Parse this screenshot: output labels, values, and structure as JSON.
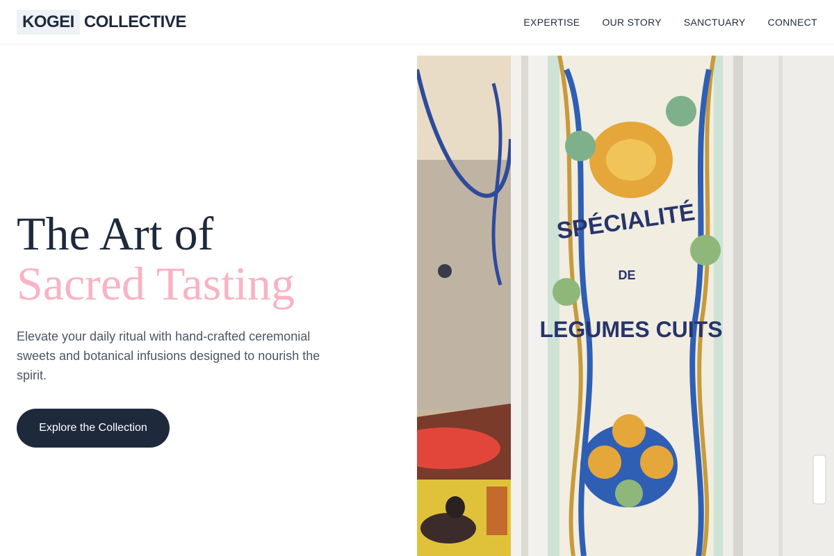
{
  "brand": {
    "logo_first": "KOGEI",
    "logo_second": "COLLECTIVE"
  },
  "nav": {
    "items": [
      "EXPERTISE",
      "OUR STORY",
      "SANCTUARY",
      "CONNECT"
    ]
  },
  "hero": {
    "headline_line1": "The Art of",
    "headline_line2": "Sacred Tasting",
    "description": "Elevate your daily ritual with hand-crafted ceremonial sweets and botanical infusions designed to nourish the spirit.",
    "cta_label": "Explore the Collection"
  },
  "photo": {
    "sign_line1": "SPÉCIALITÉ",
    "sign_line2": "DE",
    "sign_line3": "LEGUMES CUITS"
  },
  "colors": {
    "ink": "#1e293b",
    "accent_pink": "#f9b3c3",
    "button_bg": "#1e293b",
    "muted_text": "#4b5563"
  }
}
